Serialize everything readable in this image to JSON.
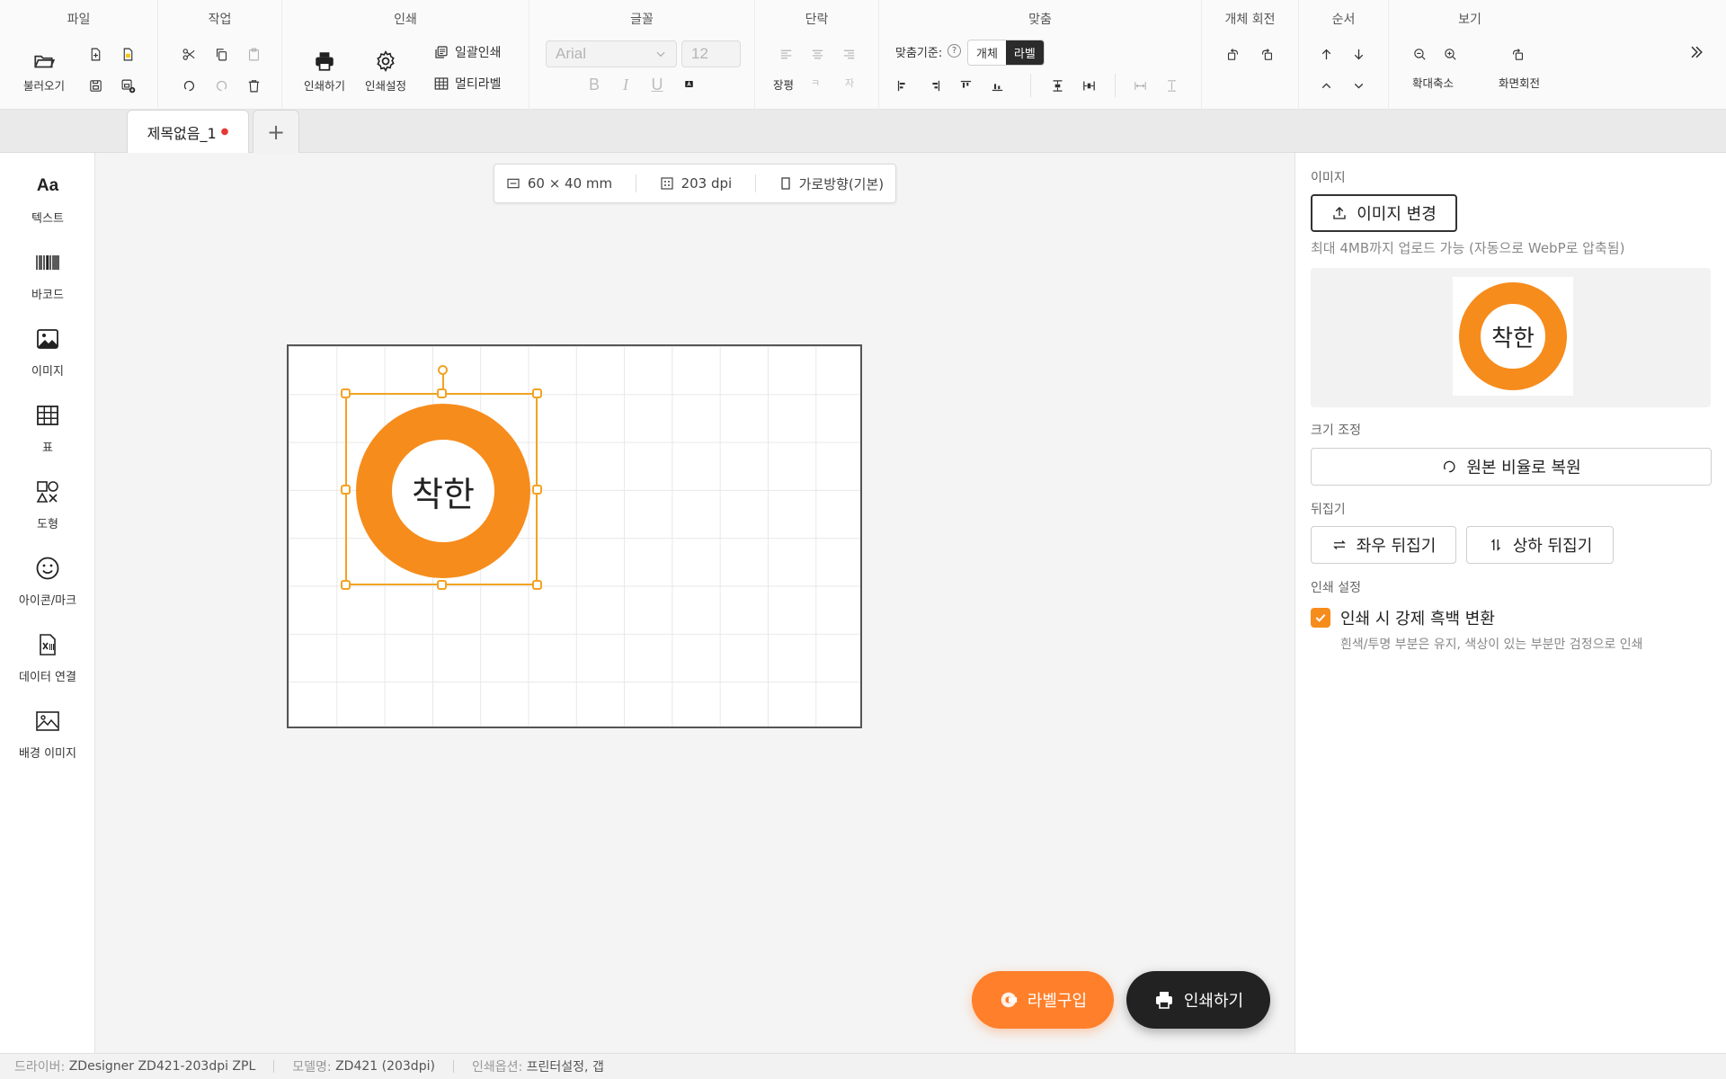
{
  "toolbar": {
    "groups": {
      "file": "파일",
      "edit": "작업",
      "print": "인쇄",
      "font": "글꼴",
      "paragraph": "단락",
      "align": "맞춤",
      "rotate": "개체 회전",
      "order": "순서",
      "view": "보기"
    },
    "open_label": "불러오기",
    "print_label": "인쇄하기",
    "print_settings_label": "인쇄설정",
    "batch_print_label": "일괄인쇄",
    "multi_label_label": "멀티라벨",
    "font_family": "Arial",
    "font_size": "12",
    "bold": "B",
    "italic": "I",
    "underline": "U",
    "paragraph_label": "장평",
    "paragraph_glyph1": "ㅋ",
    "paragraph_glyph2": "자",
    "align_ref_label": "맞춤기준:",
    "align_ref_help": "?",
    "align_ref_object": "개체",
    "align_ref_label_opt": "라벨",
    "zoom_label": "확대축소",
    "screen_rotate_label": "화면회전"
  },
  "tabs": {
    "active_tab": "제목없음_1",
    "modified_dot": "●",
    "add_tab": "+"
  },
  "sidebar": {
    "items": [
      {
        "label": "텍스트",
        "icon_text": "Aa"
      },
      {
        "label": "바코드"
      },
      {
        "label": "이미지"
      },
      {
        "label": "표"
      },
      {
        "label": "도형"
      },
      {
        "label": "아이콘/마크"
      },
      {
        "label": "데이터 연결"
      },
      {
        "label": "배경 이미지"
      }
    ]
  },
  "canvas": {
    "size": "60 × 40 mm",
    "dpi": "203 dpi",
    "orientation": "가로방향(기본)",
    "image_text": "착한"
  },
  "actions": {
    "buy_label": "라벨구입",
    "print_label": "인쇄하기"
  },
  "panel": {
    "image_section": "이미지",
    "change_image": "이미지 변경",
    "upload_hint": "최대 4MB까지 업로드 가능 (자동으로 WebP로 압축됨)",
    "preview_text": "착한",
    "resize_section": "크기 조정",
    "restore_ratio": "원본 비율로 복원",
    "flip_section": "뒤집기",
    "flip_h": "좌우 뒤집기",
    "flip_v": "상하 뒤집기",
    "print_section": "인쇄 설정",
    "force_bw": "인쇄 시 강제 흑백 변환",
    "force_bw_checked": true,
    "force_bw_hint": "흰색/투명 부분은 유지, 색상이 있는 부분만 검정으로 인쇄"
  },
  "status": {
    "driver_key": "드라이버:",
    "driver": "ZDesigner ZD421-203dpi ZPL",
    "model_key": "모델명:",
    "model": "ZD421 (203dpi)",
    "option_key": "인쇄옵션:",
    "option": "프린터설정, 갭"
  },
  "colors": {
    "accent": "#f68c1c",
    "selection": "#f2a323",
    "dark": "#222222",
    "buy_button": "#ff7f2a"
  }
}
